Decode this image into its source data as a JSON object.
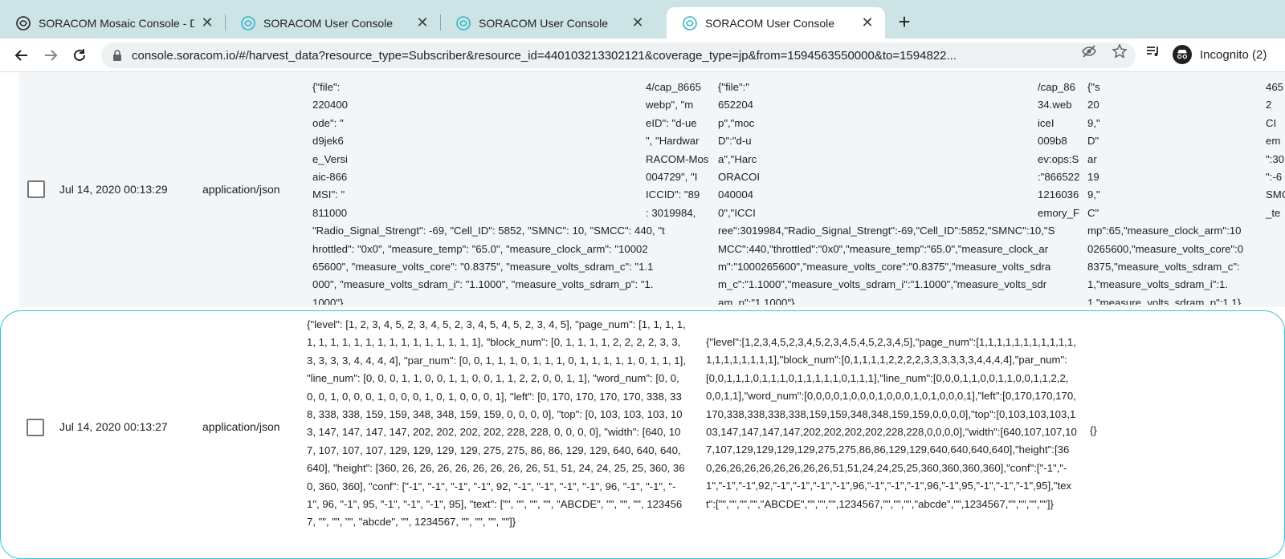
{
  "tabs": [
    {
      "title": "SORACOM Mosaic Console - D",
      "active": false
    },
    {
      "title": "SORACOM User Console",
      "active": false
    },
    {
      "title": "SORACOM User Console",
      "active": false
    },
    {
      "title": "SORACOM User Console",
      "active": true
    }
  ],
  "toolbar": {
    "url": "console.soracom.io/#/harvest_data?resource_type=Subscriber&resource_id=440103213302121&coverage_type=jp&from=1594563550000&to=1594822...",
    "profile_label": "Incognito (2)"
  },
  "rows": [
    {
      "checked": false,
      "timestamp": "Jul 14, 2020 00:13:29",
      "content_type": "application/json",
      "value_pretty_lines": [
        "{\"file\":",
        "220400",
        "ode\": \"",
        "d9jek6",
        "e_Versi",
        "aic-866",
        "MSI\": \"",
        "811000",
        "\"Radio_Signal_Strengt\": -69, \"Cell_ID\": 5852, \"SMNC\": 10, \"SMCC\": 440, \"t",
        "hrottled\": \"0x0\", \"measure_temp\": \"65.0\", \"measure_clock_arm\": \"10002",
        "65600\", \"measure_volts_core\": \"0.8375\", \"measure_volts_sdram_c\": \"1.1",
        "000\", \"measure_volts_sdram_i\": \"1.1000\", \"measure_volts_sdram_p\": \"1.",
        "1000\"}"
      ],
      "value_pretty_right": [
        "4/cap_8665",
        "webp\", \"m",
        "eID\": \"d-ue",
        "\", \"Hardwar",
        "RACOM-Mos",
        "004729\", \"I",
        "ICCID\": \"89",
        ": 3019984,"
      ],
      "value_raw_lines": [
        "{\"file\":\"",
        "652204",
        "p\",\"moc",
        "D\":\"d-u",
        "a\",\"Harc",
        "ORACOI",
        "040004",
        "0\",\"ICCI",
        "ree\":3019984,\"Radio_Signal_Strengt\":-69,\"Cell_ID\":5852,\"SMNC\":10,\"S",
        "MCC\":440,\"throttled\":\"0x0\",\"measure_temp\":\"65.0\",\"measure_clock_ar",
        "m\":\"1000265600\",\"measure_volts_core\":\"0.8375\",\"measure_volts_sdra",
        "m_c\":\"1.1000\",\"measure_volts_sdram_i\":\"1.1000\",\"measure_volts_sdr",
        "am_p\":\"1.1000\"}"
      ],
      "value_raw_right": [
        "/cap_86",
        "34.web",
        "iceI",
        "009b8",
        "ev:ops:S",
        ":\"866522",
        "1216036",
        "emory_F"
      ],
      "decoded_lines": [
        "{\"s",
        "20",
        "9,\"",
        "D\"",
        "ar",
        "19",
        "9,\"",
        "C\"",
        "mp\":65,\"measure_clock_arm\":10",
        "0265600,\"measure_volts_core\":0",
        "8375,\"measure_volts_sdram_c\":",
        "1,\"measure_volts_sdram_i\":1.",
        "1,\"measure_volts_sdram_p\":1.1}"
      ],
      "decoded_right": [
        "465",
        "2",
        "CI",
        "em",
        "\":30",
        "\":-6",
        "SMC",
        "_te"
      ]
    },
    {
      "checked": false,
      "timestamp": "Jul 14, 2020 00:13:27",
      "content_type": "application/json",
      "value_pretty": "{\"level\": [1, 2, 3, 4, 5, 2, 3, 4, 5, 2, 3, 4, 5, 4, 5, 2, 3, 4, 5], \"page_num\": [1, 1, 1, 1, 1, 1, 1, 1, 1, 1, 1, 1, 1, 1, 1, 1, 1, 1, 1], \"block_num\": [0, 1, 1, 1, 1, 2, 2, 2, 2, 3, 3, 3, 3, 3, 3, 4, 4, 4, 4], \"par_num\": [0, 0, 1, 1, 1, 0, 1, 1, 1, 0, 1, 1, 1, 1, 1, 0, 1, 1, 1], \"line_num\": [0, 0, 0, 1, 1, 0, 0, 1, 1, 0, 0, 1, 1, 2, 2, 0, 0, 1, 1], \"word_num\": [0, 0, 0, 0, 1, 0, 0, 0, 1, 0, 0, 0, 1, 0, 1, 0, 0, 0, 1], \"left\": [0, 170, 170, 170, 170, 338, 338, 338, 338, 159, 159, 348, 348, 159, 159, 0, 0, 0, 0], \"top\": [0, 103, 103, 103, 103, 147, 147, 147, 147, 202, 202, 202, 202, 228, 228, 0, 0, 0, 0], \"width\": [640, 107, 107, 107, 107, 129, 129, 129, 129, 275, 275, 86, 86, 129, 129, 640, 640, 640, 640], \"height\": [360, 26, 26, 26, 26, 26, 26, 26, 26, 51, 51, 24, 24, 25, 25, 360, 360, 360, 360], \"conf\": [\"-1\", \"-1\", \"-1\", \"-1\", 92, \"-1\", \"-1\", \"-1\", \"-1\", 96, \"-1\", \"-1\", \"-1\", 96, \"-1\", 95, \"-1\", \"-1\", \"-1\", 95], \"text\": [\"\", \"\", \"\", \"\", \"ABCDE\", \"\", \"\", \"\", 1234567, \"\", \"\", \"\", \"abcde\", \"\", 1234567, \"\", \"\", \"\", \"\"]}",
      "value_raw": "{\"level\":[1,2,3,4,5,2,3,4,5,2,3,4,5,4,5,2,3,4,5],\"page_num\":[1,1,1,1,1,1,1,1,1,1,1,1,1,1,1,1,1,1,1],\"block_num\":[0,1,1,1,1,2,2,2,2,3,3,3,3,3,3,4,4,4,4],\"par_num\":[0,0,1,1,1,0,1,1,1,0,1,1,1,1,1,0,1,1,1],\"line_num\":[0,0,0,1,1,0,0,1,1,0,0,1,1,2,2,0,0,1,1],\"word_num\":[0,0,0,0,1,0,0,0,1,0,0,0,1,0,1,0,0,0,1],\"left\":[0,170,170,170,170,338,338,338,338,159,159,348,348,159,159,0,0,0,0],\"top\":[0,103,103,103,103,147,147,147,147,202,202,202,202,228,228,0,0,0,0],\"width\":[640,107,107,107,107,129,129,129,129,275,275,86,86,129,129,640,640,640,640],\"height\":[360,26,26,26,26,26,26,26,26,51,51,24,24,25,25,360,360,360,360],\"conf\":[\"-1\",\"-1\",\"-1\",\"-1\",92,\"-1\",\"-1\",\"-1\",\"-1\",96,\"-1\",\"-1\",\"-1\",96,\"-1\",95,\"-1\",\"-1\",\"-1\",95],\"text\":[\"\",\"\",\"\",\"\",\"ABCDE\",\"\",\"\",\"\",1234567,\"\",\"\",\"\",\"abcde\",\"\",1234567,\"\",\"\",\"\",\"\"]}",
      "decoded": "{}"
    }
  ],
  "colors": {
    "tabstrip": "#cde4e7",
    "selected_outline": "#34c6d6",
    "row_stripe": "#f2f6f8"
  },
  "icons": [
    "soracom-mosaic-icon",
    "soracom-icon",
    "close-icon",
    "plus-icon",
    "back-icon",
    "forward-icon",
    "reload-icon",
    "lock-icon",
    "eye-off-icon",
    "star-icon",
    "media-queue-icon",
    "incognito-icon",
    "checkbox-icon"
  ]
}
